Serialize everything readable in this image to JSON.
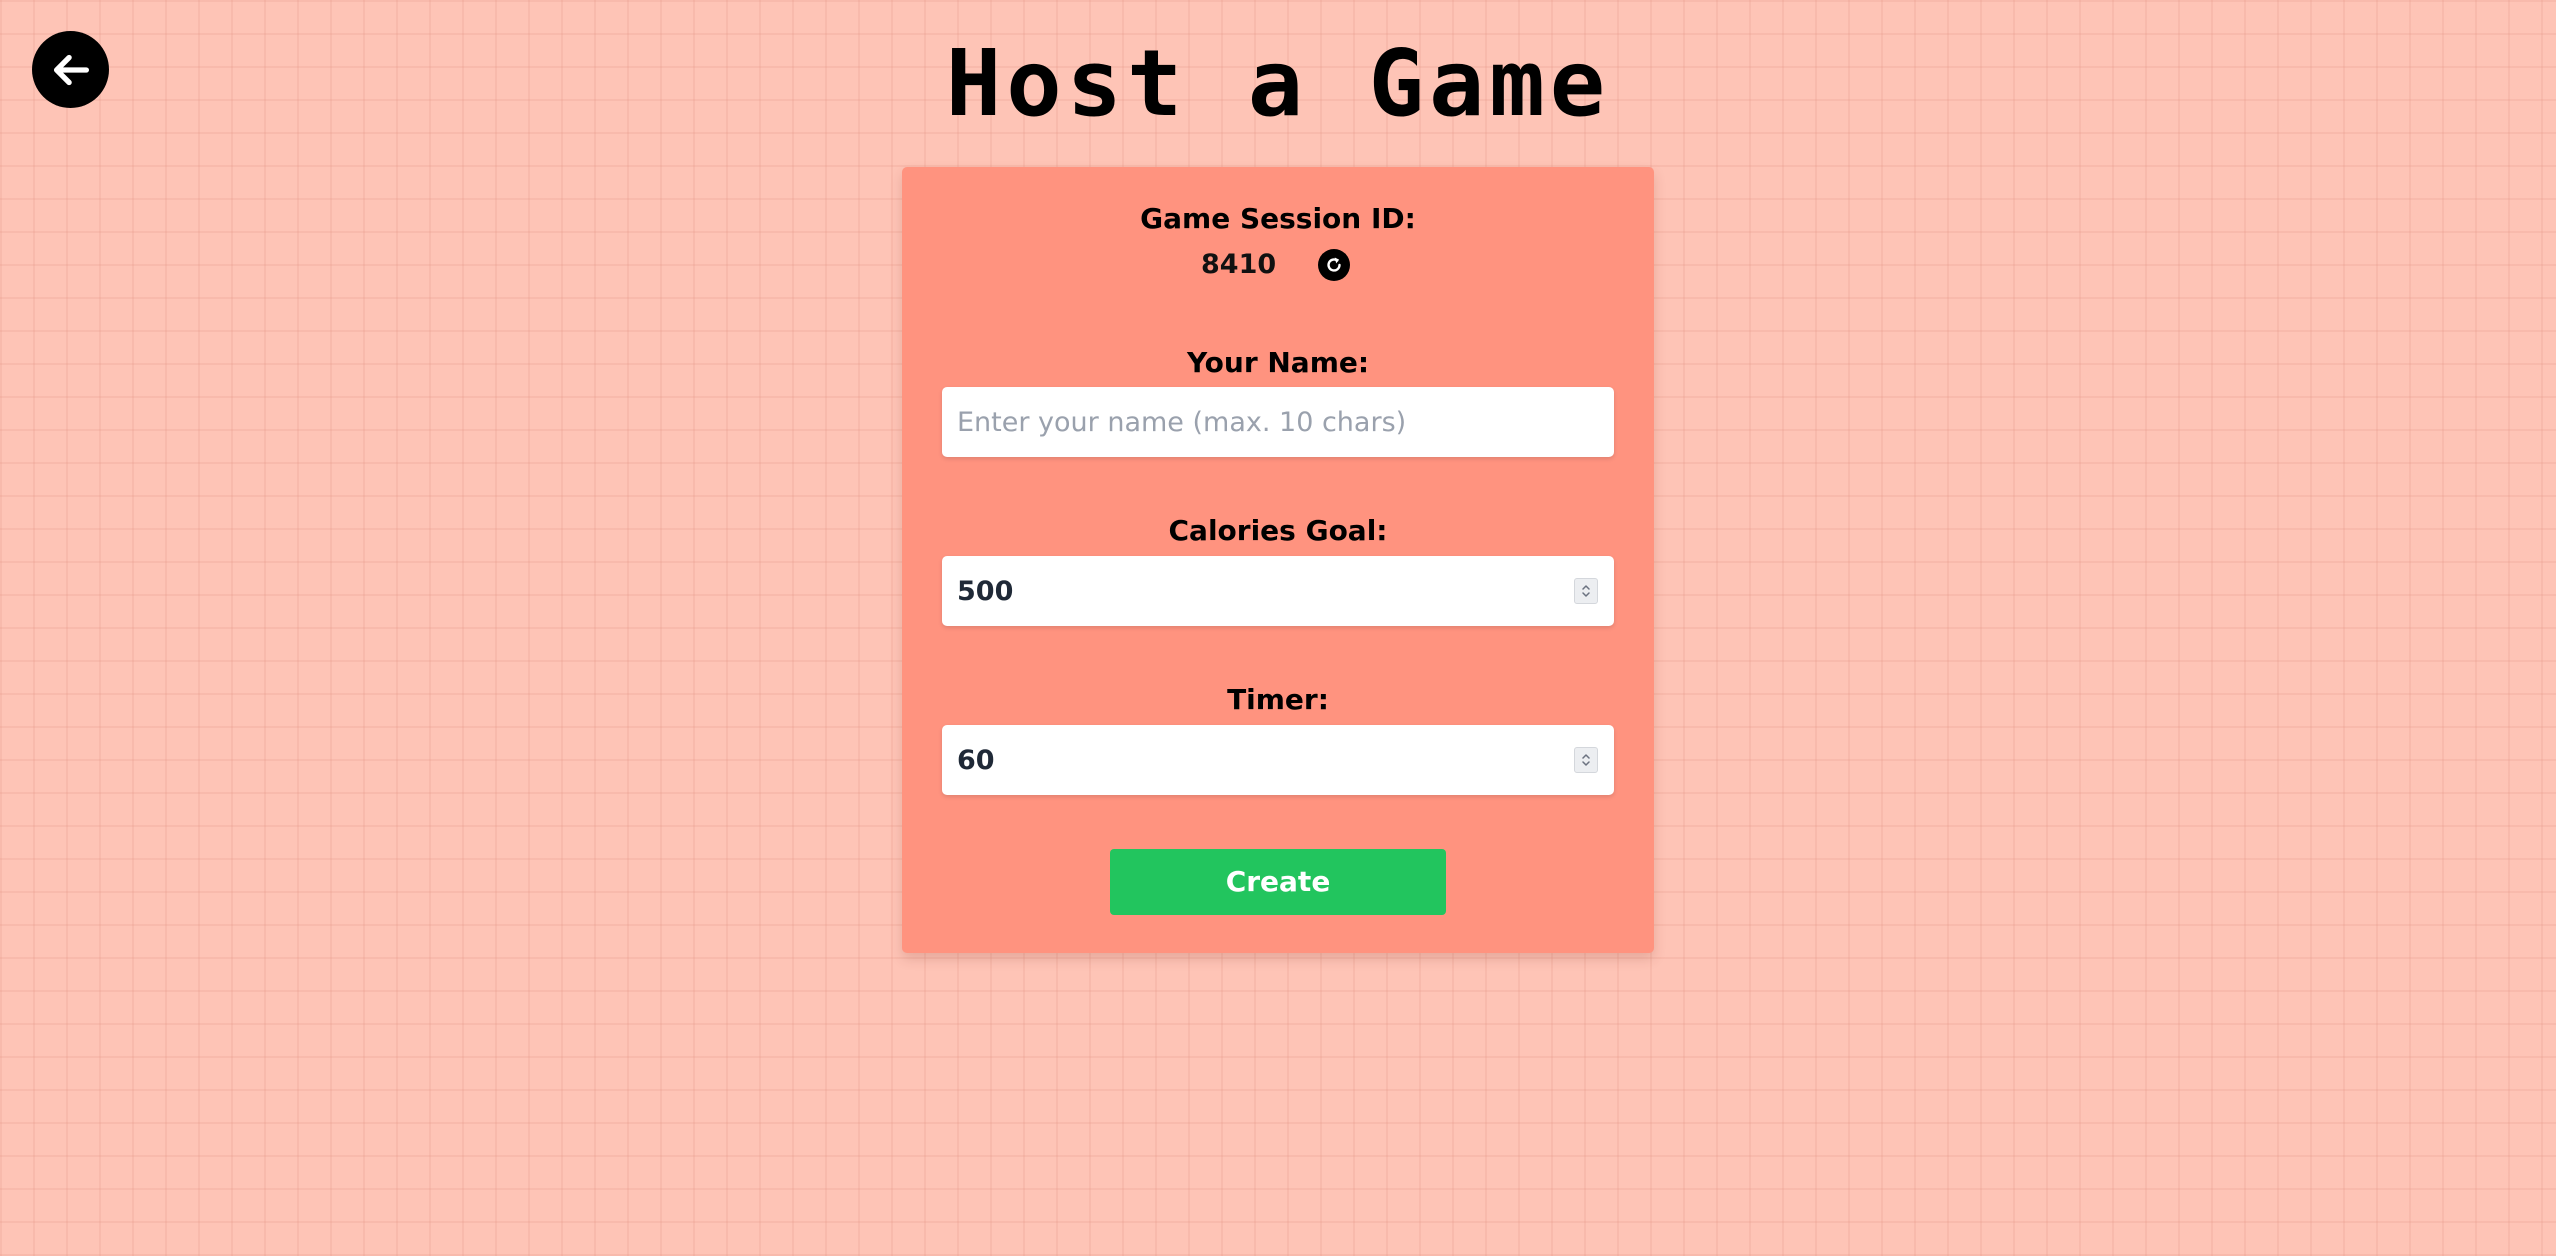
{
  "header": {
    "back_icon": "arrow-left-icon",
    "title": "Host a Game"
  },
  "session": {
    "label": "Game Session ID:",
    "id": "8410",
    "refresh_icon": "refresh-icon"
  },
  "form": {
    "name": {
      "label": "Your Name:",
      "value": "",
      "placeholder": "Enter your name (max. 10 chars)"
    },
    "calories": {
      "label": "Calories Goal:",
      "value": "500",
      "spinner_icon": "spinner-arrows-icon"
    },
    "timer": {
      "label": "Timer:",
      "value": "60",
      "spinner_icon": "spinner-arrows-icon"
    },
    "create_label": "Create"
  },
  "colors": {
    "background": "#fec4b6",
    "card": "#ff937f",
    "accent": "#22c55e",
    "text": "#000000"
  }
}
